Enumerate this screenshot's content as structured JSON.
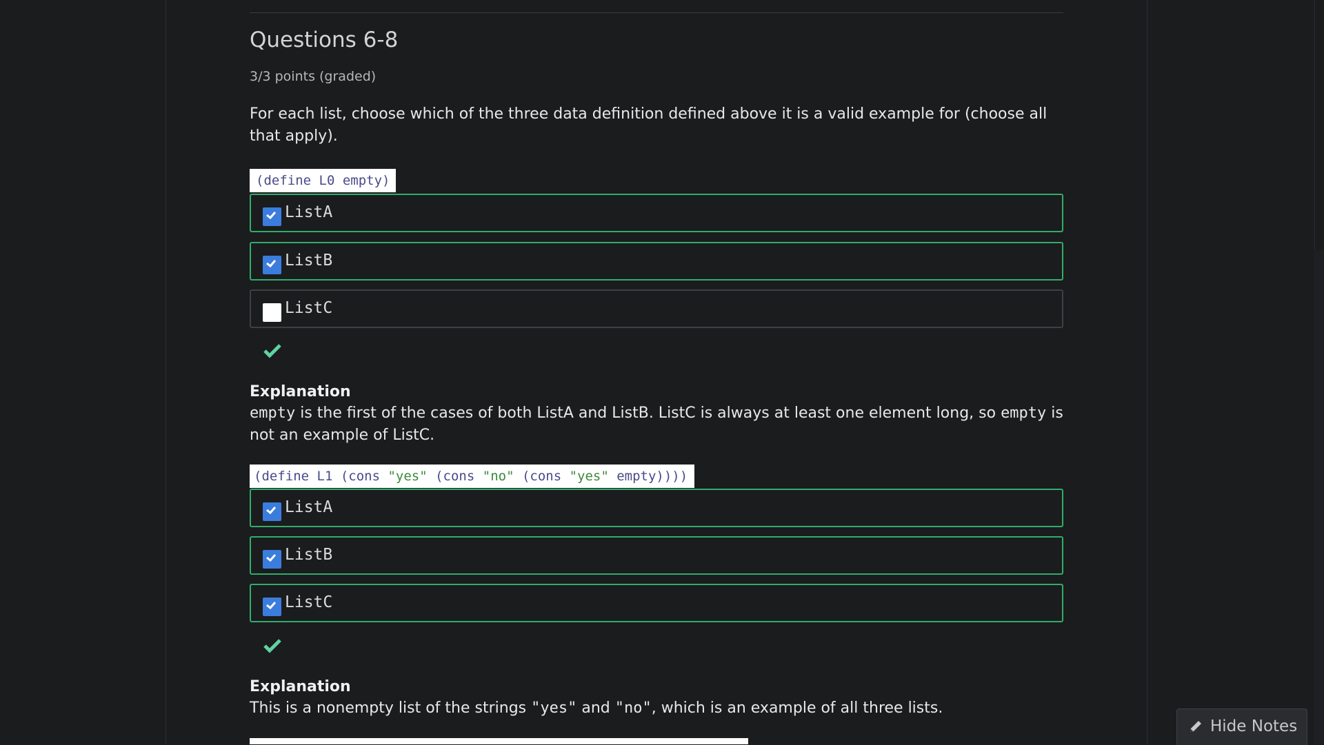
{
  "section": {
    "title": "Questions 6-8",
    "points": "3/3 points (graded)",
    "prompt": "For each list, choose which of the three data definition defined above it is a valid example for (choose all that apply)."
  },
  "questions": [
    {
      "code_parts": [
        "(define L0 empty)"
      ],
      "options": [
        {
          "label": "ListA",
          "checked": true
        },
        {
          "label": "ListB",
          "checked": true
        },
        {
          "label": "ListC",
          "checked": false
        }
      ],
      "explanation_heading": "Explanation",
      "explanation": {
        "part1_code": "empty",
        "part2": " is the first of the cases of both ListA and ListB. ListC is always at least one element long, so ",
        "part3_code": "empty",
        "part4": " is not an example of ListC."
      }
    },
    {
      "code": {
        "a": "(define L1 (cons ",
        "s1": "\"yes\"",
        "b": " (cons ",
        "s2": "\"no\"",
        "c": " (cons ",
        "s3": "\"yes\"",
        "d": " empty))))"
      },
      "options": [
        {
          "label": "ListA",
          "checked": true
        },
        {
          "label": "ListB",
          "checked": true
        },
        {
          "label": "ListC",
          "checked": true
        }
      ],
      "explanation_heading": "Explanation",
      "explanation": {
        "part1": "This is a nonempty list of the strings ",
        "part2_code": "\"yes\"",
        "part3": " and ",
        "part4_code": "\"no\"",
        "part5": ", which is an example of all three lists."
      }
    }
  ],
  "notes_button": {
    "label": "Hide Notes",
    "icon": "pencil-icon"
  },
  "colors": {
    "background": "#1b1c1e",
    "correct_border": "#2fae6b",
    "checkbox_checked": "#3b7ddd",
    "check_mark": "#5fd3a0"
  }
}
